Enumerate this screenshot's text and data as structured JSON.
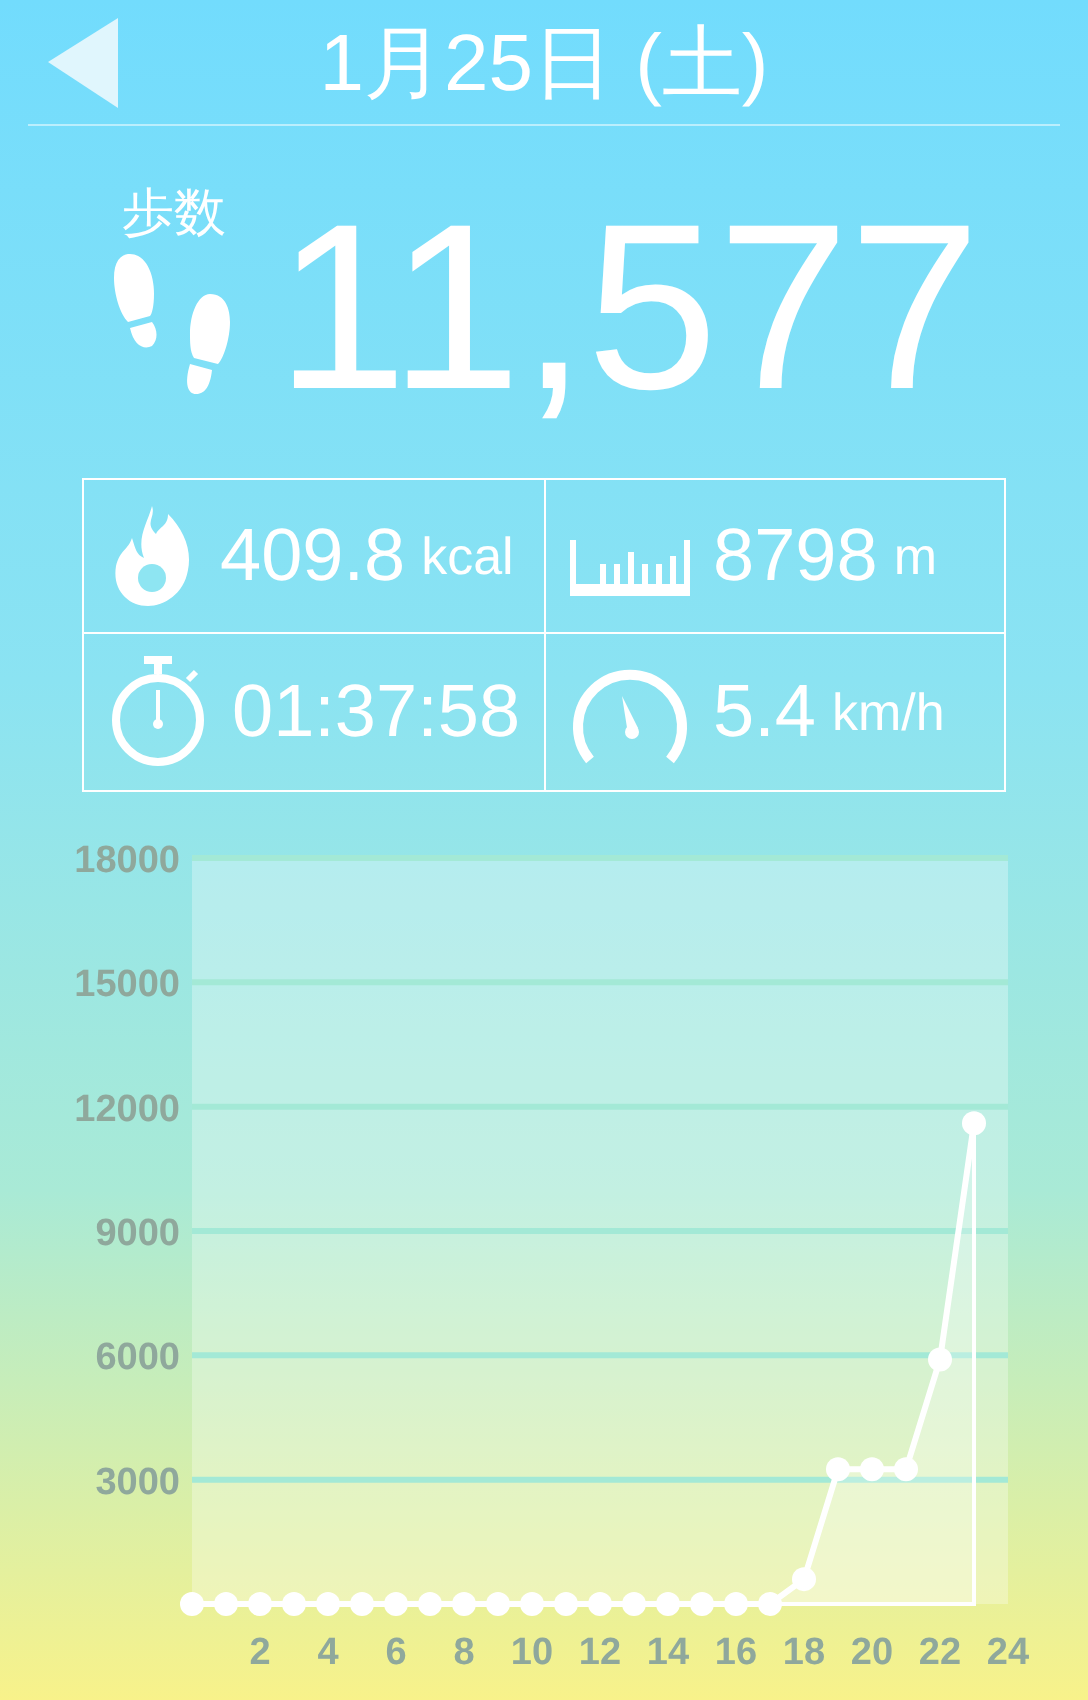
{
  "header": {
    "title": "1月25日 (土)"
  },
  "steps": {
    "label": "歩数",
    "value": "11,577"
  },
  "stats": [
    {
      "kind": "calories",
      "value": "409.8",
      "unit": "kcal"
    },
    {
      "kind": "distance",
      "value": "8798",
      "unit": "m"
    },
    {
      "kind": "time",
      "value": "01:37:58"
    },
    {
      "kind": "speed",
      "value": "5.4",
      "unit": "km/h"
    }
  ],
  "chart": {
    "chart_data": {
      "type": "area",
      "x": [
        0,
        1,
        2,
        3,
        4,
        5,
        6,
        7,
        8,
        9,
        10,
        11,
        12,
        13,
        14,
        15,
        16,
        17,
        18,
        19,
        20,
        21,
        22,
        23
      ],
      "series": [
        {
          "color": "#ffffff",
          "values": [
            0,
            0,
            0,
            0,
            0,
            0,
            0,
            0,
            0,
            0,
            0,
            0,
            0,
            0,
            0,
            0,
            0,
            0,
            600,
            3250,
            3250,
            3250,
            5900,
            11600
          ]
        }
      ],
      "grid": true,
      "xlim": [
        0,
        24
      ],
      "ylim": [
        0,
        18000
      ],
      "xticks": [
        2,
        4,
        6,
        8,
        10,
        12,
        14,
        16,
        18,
        20,
        22,
        24
      ],
      "yticks": [
        3000,
        6000,
        9000,
        12000,
        15000,
        18000
      ]
    }
  }
}
